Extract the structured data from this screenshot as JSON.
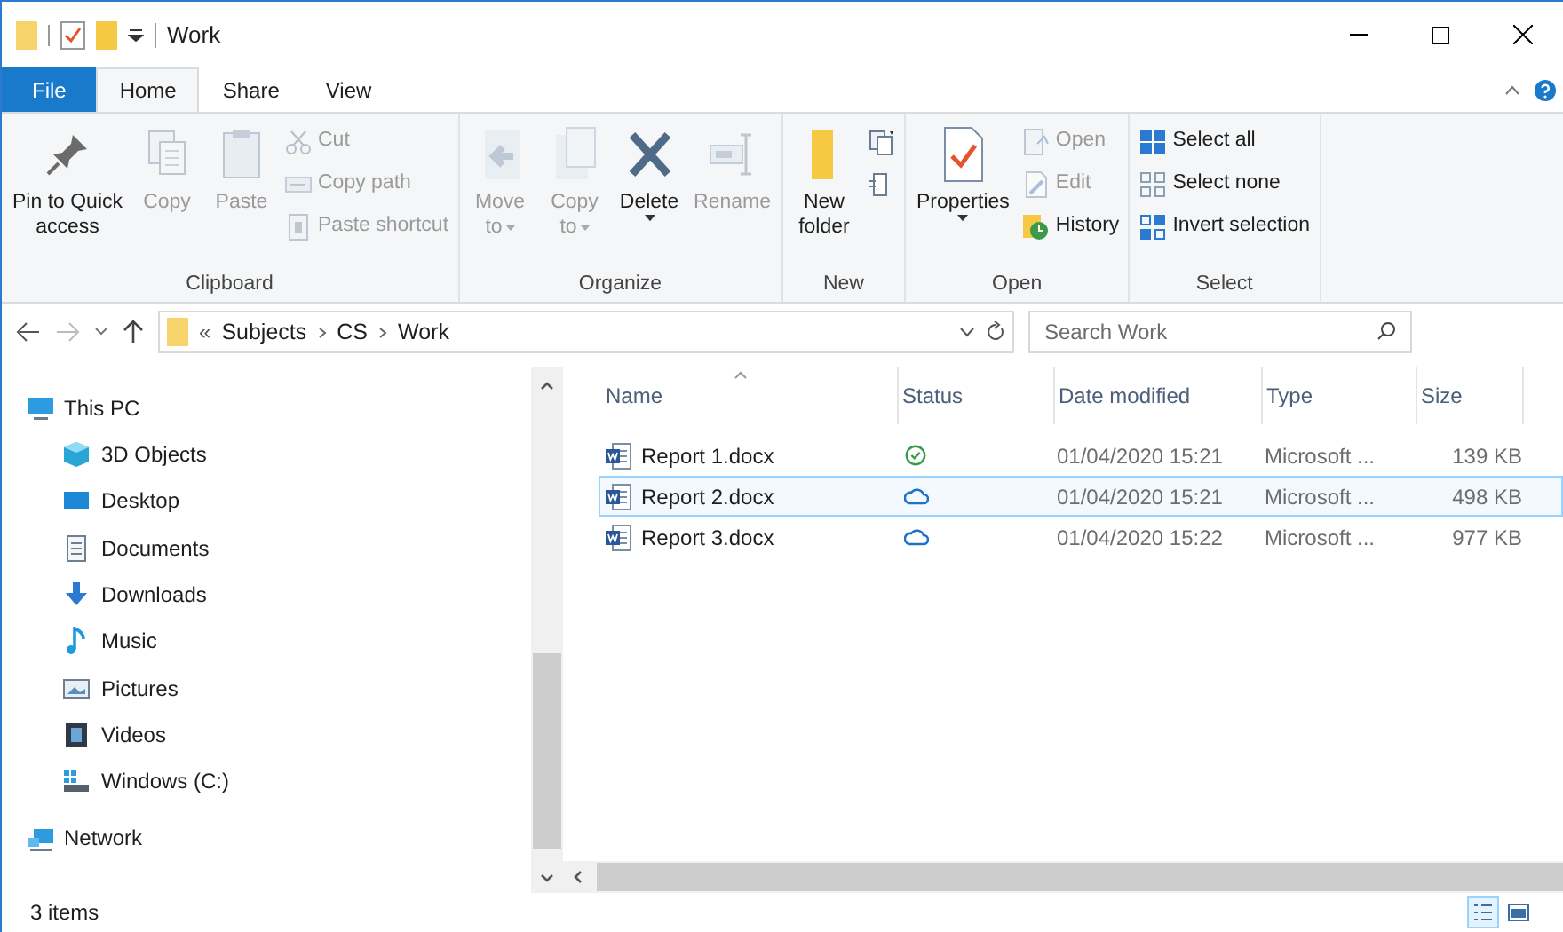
{
  "window": {
    "title": "Work"
  },
  "tabs": [
    {
      "label": "File",
      "kind": "file",
      "selected": false
    },
    {
      "label": "Home",
      "kind": "tab",
      "selected": true
    },
    {
      "label": "Share",
      "kind": "tab",
      "selected": false
    },
    {
      "label": "View",
      "kind": "tab",
      "selected": false
    }
  ],
  "ribbon": [
    {
      "name": "Clipboard",
      "items": [
        {
          "kind": "large",
          "lines": [
            "Pin to Quick",
            "access"
          ],
          "disabled": false,
          "dropdown": false
        },
        {
          "kind": "large",
          "lines": [
            "Copy"
          ],
          "disabled": true,
          "dropdown": false
        },
        {
          "kind": "large",
          "lines": [
            "Paste"
          ],
          "disabled": true,
          "dropdown": false
        },
        {
          "kind": "stack",
          "items": [
            {
              "label": "Cut",
              "disabled": true
            },
            {
              "label": "Copy path",
              "disabled": true
            },
            {
              "label": "Paste shortcut",
              "disabled": true
            }
          ]
        }
      ]
    },
    {
      "name": "Organize",
      "items": [
        {
          "kind": "large",
          "lines": [
            "Move",
            "to"
          ],
          "disabled": true,
          "dropdown": true
        },
        {
          "kind": "large",
          "lines": [
            "Copy",
            "to"
          ],
          "disabled": true,
          "dropdown": true
        },
        {
          "kind": "large",
          "lines": [
            "Delete"
          ],
          "disabled": false,
          "dropdown": true
        },
        {
          "kind": "large",
          "lines": [
            "Rename"
          ],
          "disabled": true,
          "dropdown": false
        }
      ]
    },
    {
      "name": "New",
      "items": [
        {
          "kind": "large",
          "lines": [
            "New",
            "folder"
          ],
          "disabled": false,
          "dropdown": false
        },
        {
          "kind": "stack",
          "items": [
            {
              "disabled": false
            },
            {
              "disabled": false
            }
          ]
        }
      ]
    },
    {
      "name": "Open",
      "items": [
        {
          "kind": "large",
          "lines": [
            "Properties"
          ],
          "disabled": false,
          "dropdown": true
        },
        {
          "kind": "stack",
          "items": [
            {
              "label": "Open",
              "disabled": true
            },
            {
              "label": "Edit",
              "disabled": true
            },
            {
              "label": "History",
              "disabled": false
            }
          ]
        }
      ]
    },
    {
      "name": "Select",
      "items": [
        {
          "kind": "stack",
          "items": [
            {
              "label": "Select all",
              "disabled": false
            },
            {
              "label": "Select none",
              "disabled": false
            },
            {
              "label": "Invert selection",
              "disabled": false
            }
          ]
        }
      ]
    }
  ],
  "address": {
    "overflow": "«",
    "crumbs": [
      "Subjects",
      "CS",
      "Work"
    ]
  },
  "search": {
    "placeholder": "Search Work"
  },
  "nav": [
    {
      "label": "This PC",
      "children": [
        {
          "label": "3D Objects"
        },
        {
          "label": "Desktop"
        },
        {
          "label": "Documents"
        },
        {
          "label": "Downloads"
        },
        {
          "label": "Music"
        },
        {
          "label": "Pictures"
        },
        {
          "label": "Videos"
        },
        {
          "label": "Windows (C:)"
        }
      ]
    },
    {
      "label": "Network"
    }
  ],
  "table": {
    "columns": [
      "Name",
      "Status",
      "Date modified",
      "Type",
      "Size"
    ],
    "rows": [
      {
        "name": "Report 1.docx",
        "synced": true,
        "date": "01/04/2020 15:21",
        "type": "Microsoft ...",
        "size": "139 KB",
        "selected": false
      },
      {
        "name": "Report 2.docx",
        "synced": false,
        "date": "01/04/2020 15:21",
        "type": "Microsoft ...",
        "size": "498 KB",
        "selected": true
      },
      {
        "name": "Report 3.docx",
        "synced": false,
        "date": "01/04/2020 15:22",
        "type": "Microsoft ...",
        "size": "977 KB",
        "selected": false
      }
    ]
  },
  "status_bar": {
    "count": "3 items",
    "views": [
      {
        "kind": "details",
        "selected": true
      },
      {
        "kind": "preview",
        "selected": false
      }
    ]
  }
}
